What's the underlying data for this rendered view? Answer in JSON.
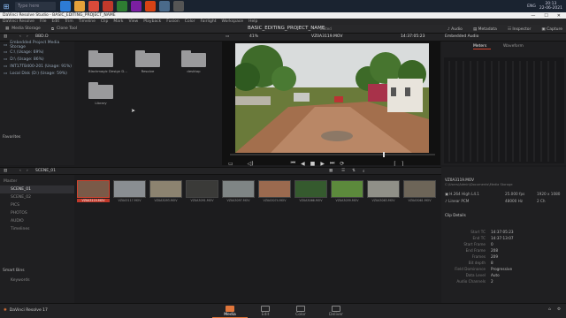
{
  "taskbar": {
    "search_placeholder": "Type here",
    "clock_time": "20:13",
    "clock_date": "22-06-2021",
    "lang": "ENG"
  },
  "window": {
    "title": "DaVinci Resolve Studio - BASIC_EDITING_PROJECT_NAME",
    "min": "—",
    "max": "☐",
    "close": "✕"
  },
  "menu": [
    "DaVinci Resolve",
    "File",
    "Edit",
    "Trim",
    "Timeline",
    "Clip",
    "Mark",
    "View",
    "Playback",
    "Fusion",
    "Color",
    "Fairlight",
    "Workspace",
    "Help"
  ],
  "header": {
    "media_storage": "Media Storage",
    "clone_tool": "Clone Tool",
    "project_title": "BASIC_EDITING_PROJECT_NAME",
    "edited": "Edited",
    "audio": "Audio",
    "metadata": "Metadata",
    "inspector": "Inspector",
    "capture": "Capture"
  },
  "subheader": {
    "path": "BBD.D",
    "zoom": "41%",
    "clip_name": "VZ0A3119.MOV",
    "timecode": "14:37:05:23",
    "embedded_audio": "Embedded Audio",
    "tab_meters": "Meters",
    "tab_waveform": "Waveform"
  },
  "locations": [
    "Embedded Project Media Storage",
    "C:\\ (Usage: 69%)",
    "D:\\ (Usage: 86%)",
    "INT17TB400-201 (Usage: 91%)",
    "Local Disk (D:) (Usage: 59%)"
  ],
  "favorites": "Favorites",
  "folders": [
    {
      "label": "Blackmagic Design D..."
    },
    {
      "label": "Resolve"
    },
    {
      "label": "desktop"
    },
    {
      "label": "Library"
    }
  ],
  "transport": {
    "timecode": ""
  },
  "bins": {
    "title": "SCENE_01",
    "items": [
      "Master",
      "SCENE_01",
      "SCENE_02",
      "PICS",
      "PHOTOS",
      "AUDIO",
      "Timelines"
    ],
    "selected": 1,
    "smart_bins": "Smart Bins",
    "keywords": "Keywords"
  },
  "clips": [
    {
      "name": "VZ0A3119.MOV",
      "color": "#7a5a48"
    },
    {
      "name": "VZ0A3117.MOV",
      "color": "#8a8e92"
    },
    {
      "name": "VZ0A3093.MOV",
      "color": "#8c8370"
    },
    {
      "name": "VZ0A3091.MOV",
      "color": "#3a3a38"
    },
    {
      "name": "VZ0A3097.MOV",
      "color": "#7f8585"
    },
    {
      "name": "VZ0A3074.MOV",
      "color": "#9b6a4f"
    },
    {
      "name": "VZ0A3066.MOV",
      "color": "#355a2e"
    },
    {
      "name": "VZ0A3059.MOV",
      "color": "#5c8a3c"
    },
    {
      "name": "VZ0A3063.MOV",
      "color": "#909088"
    },
    {
      "name": "VZ0A3061.MOV",
      "color": "#6d6558"
    }
  ],
  "metadata": {
    "title": "Metadata",
    "mediapool": "Media Pool",
    "clip": "VZ0A3119.MOV",
    "path": "C:\\Users\\Admin\\Documents\\Media Storage",
    "codec": "H.264 High L4.1",
    "fps": "25.000 fps",
    "res": "1920 x 1080",
    "audio": "Linear PCM",
    "hz": "48000 Hz",
    "ch": "2 Ch",
    "clip_details": "Clip Details",
    "rows": [
      {
        "k": "Start TC",
        "v": "14:37:05:23"
      },
      {
        "k": "End TC",
        "v": "14:37:13:07"
      },
      {
        "k": "Start Frame",
        "v": "0"
      },
      {
        "k": "End Frame",
        "v": "208"
      },
      {
        "k": "Frames",
        "v": "209"
      },
      {
        "k": "Bit depth",
        "v": "8"
      },
      {
        "k": "Field Dominance",
        "v": "Progressive"
      },
      {
        "k": "Data Level",
        "v": "Auto"
      },
      {
        "k": "Audio Channels",
        "v": "2"
      }
    ]
  },
  "pages": {
    "app_name": "DaVinci Resolve 17",
    "tabs": [
      "Media",
      "Edit",
      "Color",
      "Deliver"
    ],
    "active": 0
  }
}
